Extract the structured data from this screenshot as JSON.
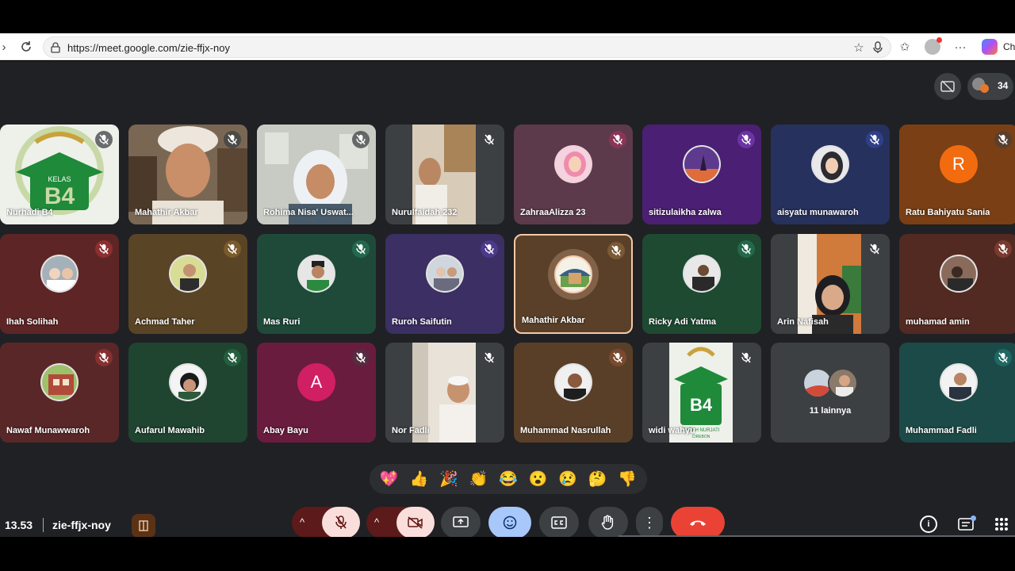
{
  "browser": {
    "url": "https://meet.google.com/zie-ffjx-noy",
    "profile_partial": "Ch"
  },
  "header": {
    "participant_count": "34"
  },
  "participants": [
    {
      "name": "Nurhadi B4",
      "mic": "muted"
    },
    {
      "name": "Mahathir Akbar",
      "mic": "muted"
    },
    {
      "name": "Rohima Nisa' Uswat...",
      "mic": "muted"
    },
    {
      "name": "Nurulfaidah 232",
      "mic": "muted"
    },
    {
      "name": "ZahraaAlizza 23",
      "mic": "muted"
    },
    {
      "name": "sitizulaikha zalwa",
      "mic": "muted"
    },
    {
      "name": "aisyatu munawaroh",
      "mic": "muted"
    },
    {
      "name": "Ratu Bahiyatu Sania",
      "mic": "muted",
      "initial": "R"
    },
    {
      "name": "Ihah Solihah",
      "mic": "muted"
    },
    {
      "name": "Achmad Taher",
      "mic": "muted"
    },
    {
      "name": "Mas Ruri",
      "mic": "muted"
    },
    {
      "name": "Ruroh Saifutin",
      "mic": "muted"
    },
    {
      "name": "Mahathir Akbar",
      "mic": "speaking"
    },
    {
      "name": "Ricky Adi Yatma",
      "mic": "muted"
    },
    {
      "name": "Arin Nafisah",
      "mic": "muted"
    },
    {
      "name": "muhamad amin",
      "mic": "muted"
    },
    {
      "name": "Nawaf Munawwaroh",
      "mic": "muted"
    },
    {
      "name": "Aufarul Mawahib",
      "mic": "muted"
    },
    {
      "name": "Abay Bayu",
      "mic": "muted",
      "initial": "A"
    },
    {
      "name": "Nor Fadli",
      "mic": "muted"
    },
    {
      "name": "Muhammad Nasrullah",
      "mic": "muted"
    },
    {
      "name": "widi wahyu",
      "mic": "muted"
    },
    {
      "name": "11 lainnya",
      "mic": "none"
    },
    {
      "name": "Muhammad Fadli",
      "mic": "muted"
    }
  ],
  "tile_logo": {
    "line1": "KELAS",
    "line2": "B4",
    "line3": "SYEKH NURJATI",
    "line4": "CIREBON"
  },
  "reactions": [
    "💖",
    "👍",
    "🎉",
    "👏",
    "😂",
    "😮",
    "😢",
    "🤔",
    "👎"
  ],
  "footer": {
    "time": "13.53",
    "meeting_code": "zie-ffjx-noy"
  },
  "colors": {
    "meet_bg": "#202124",
    "hangup": "#ea4335",
    "active_border": "#f6c9a8",
    "muted_pill": "#f9dedc"
  }
}
